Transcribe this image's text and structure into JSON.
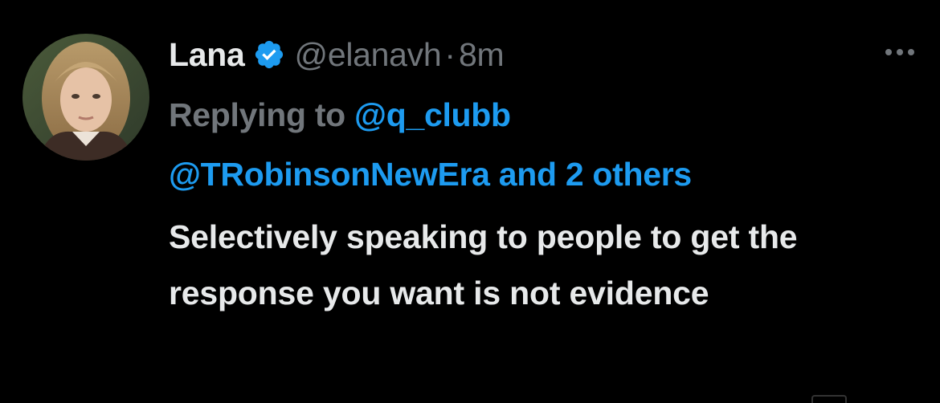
{
  "tweet": {
    "author": {
      "display_name": "Lana",
      "handle": "@elanavh",
      "verified": true,
      "avatar_icon": "profile-photo"
    },
    "separator": "·",
    "timestamp": "8m",
    "reply": {
      "prefix": "Replying to",
      "first_mention": "@q_clubb",
      "second_mention": "@TRobinsonNewEra",
      "and_others": "and 2 others"
    },
    "text": "Selectively speaking to people to get the response you want is not evidence",
    "more_icon": "ellipsis-icon"
  },
  "colors": {
    "background": "#000000",
    "primary_text": "#e7e9ea",
    "secondary_text": "#71767b",
    "link": "#1d9bf0",
    "verified_badge": "#1d9bf0"
  }
}
